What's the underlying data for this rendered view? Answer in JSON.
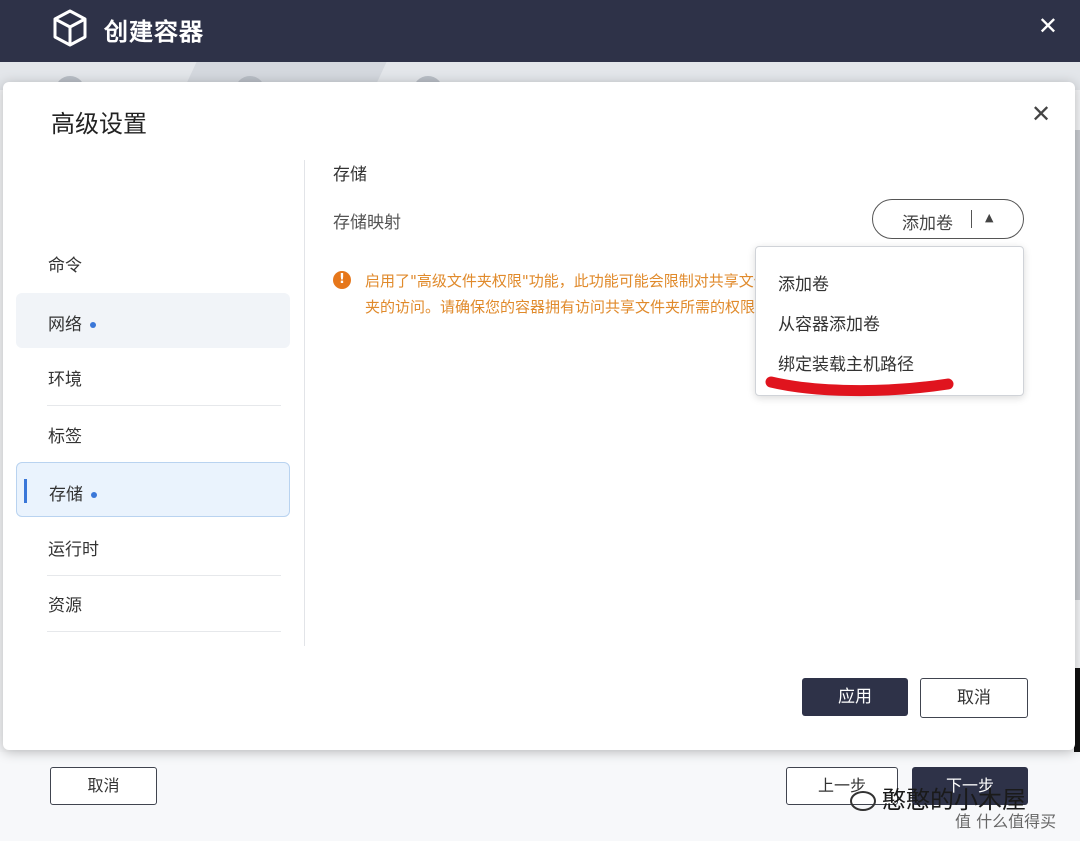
{
  "outer": {
    "title": "创建容器",
    "footer": {
      "cancel": "取消",
      "prev": "上一步",
      "next": "下一步"
    }
  },
  "modal": {
    "title": "高级设置",
    "nav": [
      {
        "label": "命令",
        "dot": false
      },
      {
        "label": "网络",
        "dot": true
      },
      {
        "label": "环境",
        "dot": false
      },
      {
        "label": "标签",
        "dot": false
      },
      {
        "label": "存储",
        "dot": true,
        "active": true
      },
      {
        "label": "运行时",
        "dot": false
      },
      {
        "label": "资源",
        "dot": false
      }
    ],
    "content": {
      "section_title": "存储",
      "field_label": "存储映射",
      "add_button": "添加卷",
      "warning": "启用了\"高级文件夹权限\"功能，此功能可能会限制对共享文件夹的访问。请确保您的容器拥有访问共享文件夹所需的权限。"
    },
    "dropdown": [
      "添加卷",
      "从容器添加卷",
      "绑定装载主机路径"
    ],
    "buttons": {
      "apply": "应用",
      "cancel": "取消"
    }
  },
  "watermark": {
    "text": "憨憨的小木屋",
    "site": "值 什么值得买"
  },
  "colors": {
    "header": "#2e3248",
    "accent": "#3a77d8",
    "warning": "#e08a2b",
    "annotation": "#e0141e"
  }
}
